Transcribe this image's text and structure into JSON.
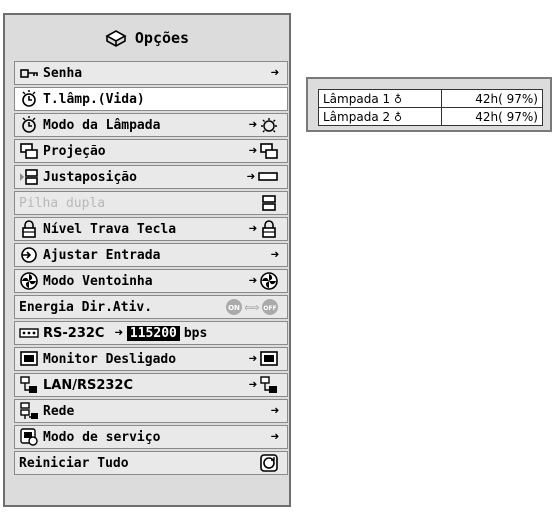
{
  "window": {
    "title": "Opções"
  },
  "menu": {
    "items": [
      {
        "label": "Senha",
        "icon": "key-icon"
      },
      {
        "label": "T.lâmp.(Vida)",
        "icon": "lamp-timer-icon"
      },
      {
        "label": "Modo da Lâmpada",
        "icon": "lamp-mode-icon"
      },
      {
        "label": "Projeção",
        "icon": "projection-icon"
      },
      {
        "label": "Justaposição",
        "icon": "stack-icon"
      },
      {
        "label": "Pilha dupla",
        "icon": "dual-stack-icon"
      },
      {
        "label": "Nível Trava Tecla",
        "icon": "lock-icon"
      },
      {
        "label": "Ajustar Entrada",
        "icon": "input-icon"
      },
      {
        "label": "Modo Ventoinha",
        "icon": "fan-icon"
      },
      {
        "label": "Energia Dir.Ativ.",
        "icon": "power-icon"
      },
      {
        "label": "RS-232C",
        "icon": "serial-port-icon"
      },
      {
        "label": "Monitor Desligado",
        "icon": "monitor-icon"
      },
      {
        "label": "LAN/RS232C",
        "icon": "network-serial-icon"
      },
      {
        "label": "Rede",
        "icon": "network-icon"
      },
      {
        "label": "Modo de serviço",
        "icon": "service-icon"
      },
      {
        "label": "Reiniciar Tudo",
        "icon": "reset-icon"
      }
    ],
    "rs232c_value": "115200",
    "rs232c_unit": "bps",
    "power_on_label": "ON",
    "power_off_label": "OFF"
  },
  "lamp_panel": {
    "rows": [
      {
        "label": "Lâmpada 1",
        "value": "42h( 97%)"
      },
      {
        "label": "Lâmpada 2",
        "value": "42h( 97%)"
      }
    ]
  }
}
